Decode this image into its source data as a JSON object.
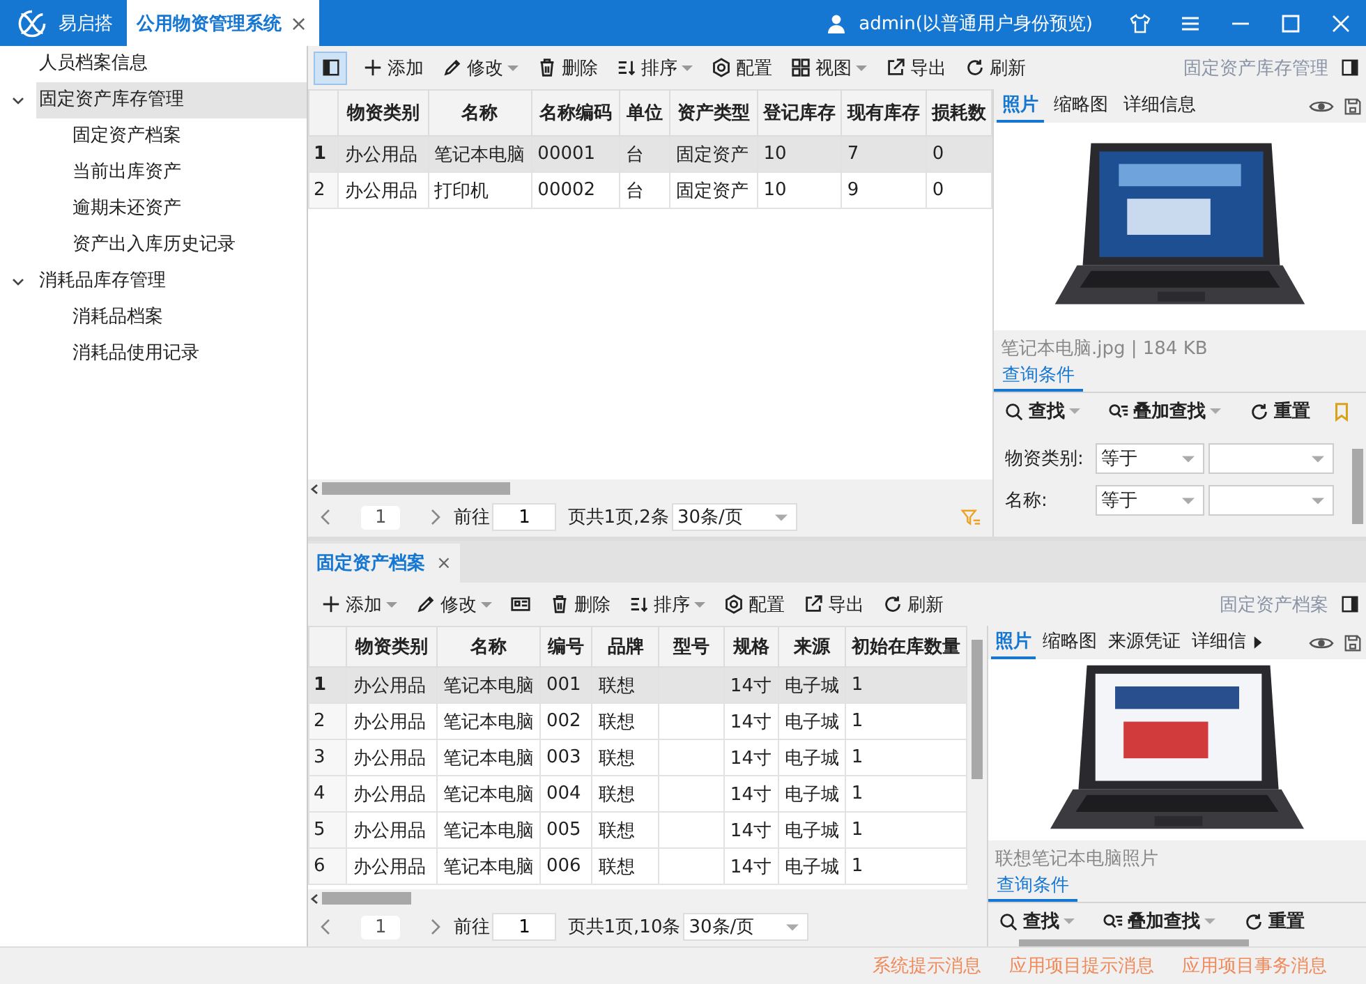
{
  "app": {
    "name": "易启搭",
    "tab": {
      "label": "公用物资管理系统",
      "selected": true,
      "close": "×"
    },
    "user": "admin(以普通用户身份预览)"
  },
  "sidebar": {
    "items": [
      {
        "label": "人员档案信息",
        "selected": false
      },
      {
        "label": "固定资产库存管理",
        "selected": true,
        "expanded": true,
        "children": [
          {
            "label": "固定资产档案",
            "selected": false
          },
          {
            "label": "当前出库资产",
            "selected": false
          },
          {
            "label": "逾期未还资产",
            "selected": false
          },
          {
            "label": "资产出入库历史记录",
            "selected": false
          }
        ]
      },
      {
        "label": "消耗品库存管理",
        "selected": false,
        "expanded": true,
        "children": [
          {
            "label": "消耗品档案",
            "selected": false
          },
          {
            "label": "消耗品使用记录",
            "selected": false
          }
        ]
      }
    ]
  },
  "panels": [
    {
      "toolbar": {
        "panel_toggle": {
          "on": true
        },
        "items": [
          {
            "kind": "add",
            "label": "添加",
            "dropdown": false
          },
          {
            "kind": "edit",
            "label": "修改",
            "dropdown": true
          },
          {
            "kind": "delete",
            "label": "删除",
            "dropdown": false
          },
          {
            "kind": "sort",
            "label": "排序",
            "dropdown": true
          },
          {
            "kind": "config",
            "label": "配置",
            "dropdown": false
          },
          {
            "kind": "view",
            "label": "视图",
            "dropdown": true
          },
          {
            "kind": "export",
            "label": "导出",
            "dropdown": false
          },
          {
            "kind": "refresh",
            "label": "刷新",
            "dropdown": false
          }
        ],
        "title": "固定资产库存管理"
      },
      "table": {
        "columns": [
          "物资类别",
          "名称",
          "名称编码",
          "单位",
          "资产类型",
          "登记库存",
          "现有库存",
          "损耗数"
        ],
        "rows": [
          {
            "index": "1",
            "selected": true,
            "cells": [
              "办公用品",
              "笔记本电脑",
              "00001",
              "台",
              "固定资产",
              "10",
              "7",
              "0"
            ]
          },
          {
            "index": "2",
            "selected": false,
            "cells": [
              "办公用品",
              "打印机",
              "00002",
              "台",
              "固定资产",
              "10",
              "9",
              "0"
            ]
          }
        ]
      },
      "pager": {
        "page": "1",
        "goto_label": "前往",
        "goto_value": "1",
        "summary": "页共1页,2条",
        "page_size": "30条/页",
        "filter": true
      },
      "side": {
        "tabs": [
          {
            "label": "照片",
            "selected": true
          },
          {
            "label": "缩略图",
            "selected": false
          },
          {
            "label": "详细信息",
            "selected": false
          }
        ],
        "caption": "笔记本电脑.jpg | 184 KB",
        "query_tab": {
          "label": "查询条件",
          "selected": true
        },
        "tools": [
          {
            "kind": "find",
            "label": "查找",
            "dropdown": true
          },
          {
            "kind": "overlay",
            "label": "叠加查找",
            "dropdown": true
          },
          {
            "kind": "reset",
            "label": "重置",
            "dropdown": false
          },
          {
            "kind": "bookmark"
          }
        ],
        "filters": [
          {
            "label": "物资类别:",
            "operator": "等于"
          },
          {
            "label": "名称:",
            "operator": "等于"
          }
        ]
      }
    },
    {
      "tab": {
        "label": "固定资产档案",
        "selected": true,
        "close": "×"
      },
      "toolbar": {
        "items": [
          {
            "kind": "add",
            "label": "添加",
            "dropdown": true
          },
          {
            "kind": "edit",
            "label": "修改",
            "dropdown": true
          },
          {
            "kind": "card"
          },
          {
            "kind": "delete",
            "label": "删除",
            "dropdown": false
          },
          {
            "kind": "sort",
            "label": "排序",
            "dropdown": true
          },
          {
            "kind": "config",
            "label": "配置",
            "dropdown": false
          },
          {
            "kind": "export",
            "label": "导出",
            "dropdown": false
          },
          {
            "kind": "refresh",
            "label": "刷新",
            "dropdown": false
          }
        ],
        "title": "固定资产档案"
      },
      "table": {
        "columns": [
          "物资类别",
          "名称",
          "编号",
          "品牌",
          "型号",
          "规格",
          "来源",
          "初始在库数量"
        ],
        "rows": [
          {
            "index": "1",
            "selected": true,
            "cells": [
              "办公用品",
              "笔记本电脑",
              "001",
              "联想",
              "",
              "14寸",
              "电子城",
              "1"
            ]
          },
          {
            "index": "2",
            "selected": false,
            "cells": [
              "办公用品",
              "笔记本电脑",
              "002",
              "联想",
              "",
              "14寸",
              "电子城",
              "1"
            ]
          },
          {
            "index": "3",
            "selected": false,
            "cells": [
              "办公用品",
              "笔记本电脑",
              "003",
              "联想",
              "",
              "14寸",
              "电子城",
              "1"
            ]
          },
          {
            "index": "4",
            "selected": false,
            "cells": [
              "办公用品",
              "笔记本电脑",
              "004",
              "联想",
              "",
              "14寸",
              "电子城",
              "1"
            ]
          },
          {
            "index": "5",
            "selected": false,
            "cells": [
              "办公用品",
              "笔记本电脑",
              "005",
              "联想",
              "",
              "14寸",
              "电子城",
              "1"
            ]
          },
          {
            "index": "6",
            "selected": false,
            "cells": [
              "办公用品",
              "笔记本电脑",
              "006",
              "联想",
              "",
              "14寸",
              "电子城",
              "1"
            ]
          }
        ]
      },
      "pager": {
        "page": "1",
        "goto_label": "前往",
        "goto_value": "1",
        "summary": "页共1页,10条",
        "page_size": "30条/页"
      },
      "side": {
        "tabs": [
          {
            "label": "照片",
            "selected": true
          },
          {
            "label": "缩略图",
            "selected": false
          },
          {
            "label": "来源凭证",
            "selected": false
          },
          {
            "label": "详细信",
            "selected": false
          }
        ],
        "caption": "联想笔记本电脑照片",
        "query_tab": {
          "label": "查询条件",
          "selected": true
        },
        "tools": [
          {
            "kind": "find",
            "label": "查找",
            "dropdown": true
          },
          {
            "kind": "overlay",
            "label": "叠加查找",
            "dropdown": true
          },
          {
            "kind": "reset",
            "label": "重置",
            "dropdown": false
          }
        ]
      }
    }
  ],
  "status_bar": {
    "messages": [
      "系统提示消息",
      "应用项目提示消息",
      "应用项目事务消息"
    ]
  }
}
